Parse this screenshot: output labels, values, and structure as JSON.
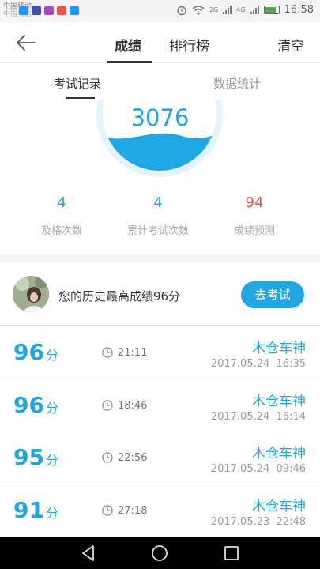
{
  "status": {
    "carrier": "中国移动",
    "carrier_sub": "中国电信",
    "network_2g": "2G",
    "network_4g": "4G",
    "time": "16:58",
    "apps": [
      "#2196f3",
      "#3f51b5",
      "#ab47bc",
      "#ef5350",
      "#2196f3"
    ]
  },
  "header": {
    "tabs": [
      "成绩",
      "排行榜"
    ],
    "active_tab": 0,
    "clear_label": "清空"
  },
  "subtabs": {
    "items": [
      "考试记录",
      "数据统计"
    ],
    "active": 0
  },
  "gauge": {
    "score": "3076"
  },
  "stats": [
    {
      "value": "4",
      "label": "及格次数"
    },
    {
      "value": "4",
      "label": "累计考试次数"
    },
    {
      "value": "94",
      "label": "成绩预测"
    }
  ],
  "best": {
    "text": "您的历史最高成绩96分",
    "button": "去考试"
  },
  "records": [
    {
      "score": "96",
      "unit": "分",
      "duration": "21:11",
      "name": "木仓车神",
      "date": "2017.05.24  16:35"
    },
    {
      "score": "96",
      "unit": "分",
      "duration": "18:46",
      "name": "木仓车神",
      "date": "2017.05.24  16:14"
    },
    {
      "score": "95",
      "unit": "分",
      "duration": "22:56",
      "name": "木仓车神",
      "date": "2017.05.24  09:46"
    },
    {
      "score": "91",
      "unit": "分",
      "duration": "27:18",
      "name": "木仓车神",
      "date": "2017.05.23  22:48"
    }
  ]
}
